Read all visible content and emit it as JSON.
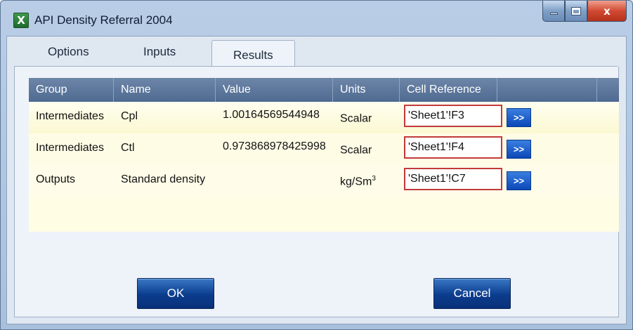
{
  "window": {
    "title": "API Density Referral 2004",
    "close_glyph": "x"
  },
  "tabs": [
    {
      "label": "Options"
    },
    {
      "label": "Inputs"
    },
    {
      "label": "Results"
    }
  ],
  "results_table": {
    "columns": [
      "Group",
      "Name",
      "Value",
      "Units",
      "Cell Reference"
    ],
    "rows": [
      {
        "group": "Intermediates",
        "name": "Cpl",
        "value": "1.00164569544948",
        "units": "Scalar",
        "unit_exp": "",
        "cell_ref": "'Sheet1'!F3",
        "button_label": ">>"
      },
      {
        "group": "Intermediates",
        "name": "Ctl",
        "value": "0.973868978425998",
        "units": "Scalar",
        "unit_exp": "",
        "cell_ref": "'Sheet1'!F4",
        "button_label": ">>"
      },
      {
        "group": "Outputs",
        "name": "Standard density",
        "value": "",
        "units": "kg/Sm",
        "unit_exp": "3",
        "cell_ref": "'Sheet1'!C7",
        "button_label": ">>"
      }
    ]
  },
  "buttons": {
    "ok": "OK",
    "cancel": "Cancel"
  },
  "icons": {
    "app": "excel-icon",
    "minimize": "minimize-icon",
    "maximize": "maximize-icon",
    "close": "close-icon"
  },
  "colors": {
    "header_bg": "#5a759c",
    "row_bg": "#fffde3",
    "ref_border": "#c23a3a",
    "button_blue": "#0b48b8"
  }
}
